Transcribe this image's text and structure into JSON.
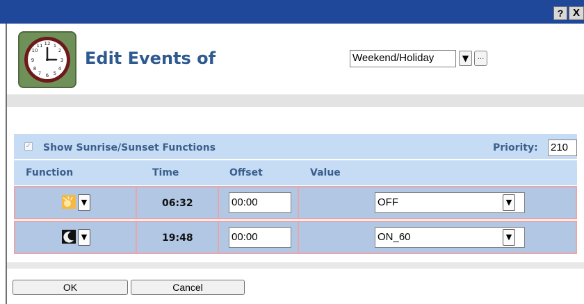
{
  "window": {
    "help_label": "?",
    "close_label": "X"
  },
  "header": {
    "title": "Edit Events of",
    "event_group": "Weekend/Holiday",
    "dropdown_glyph": "▼",
    "more_label": "..."
  },
  "options": {
    "show_sunrise_sunset_label": "Show Sunrise/Sunset Functions",
    "show_sunrise_sunset_checked": true,
    "priority_label": "Priority:",
    "priority_value": "210"
  },
  "table": {
    "columns": [
      "Function",
      "Time",
      "Offset",
      "Value"
    ],
    "rows": [
      {
        "function_icon": "sunrise-icon",
        "time": "06:32",
        "offset": "00:00",
        "value": "OFF"
      },
      {
        "function_icon": "moon-icon",
        "time": "19:48",
        "offset": "00:00",
        "value": "ON_60"
      }
    ]
  },
  "footer": {
    "ok_label": "OK",
    "cancel_label": "Cancel"
  },
  "colors": {
    "titlebar": "#20489a",
    "panel_blue": "#c6dcf5",
    "row_blue": "#b1c7e3",
    "row_border": "#e8a6aa",
    "label_blue": "#3b5f8c",
    "title_blue": "#2e5a8f"
  }
}
